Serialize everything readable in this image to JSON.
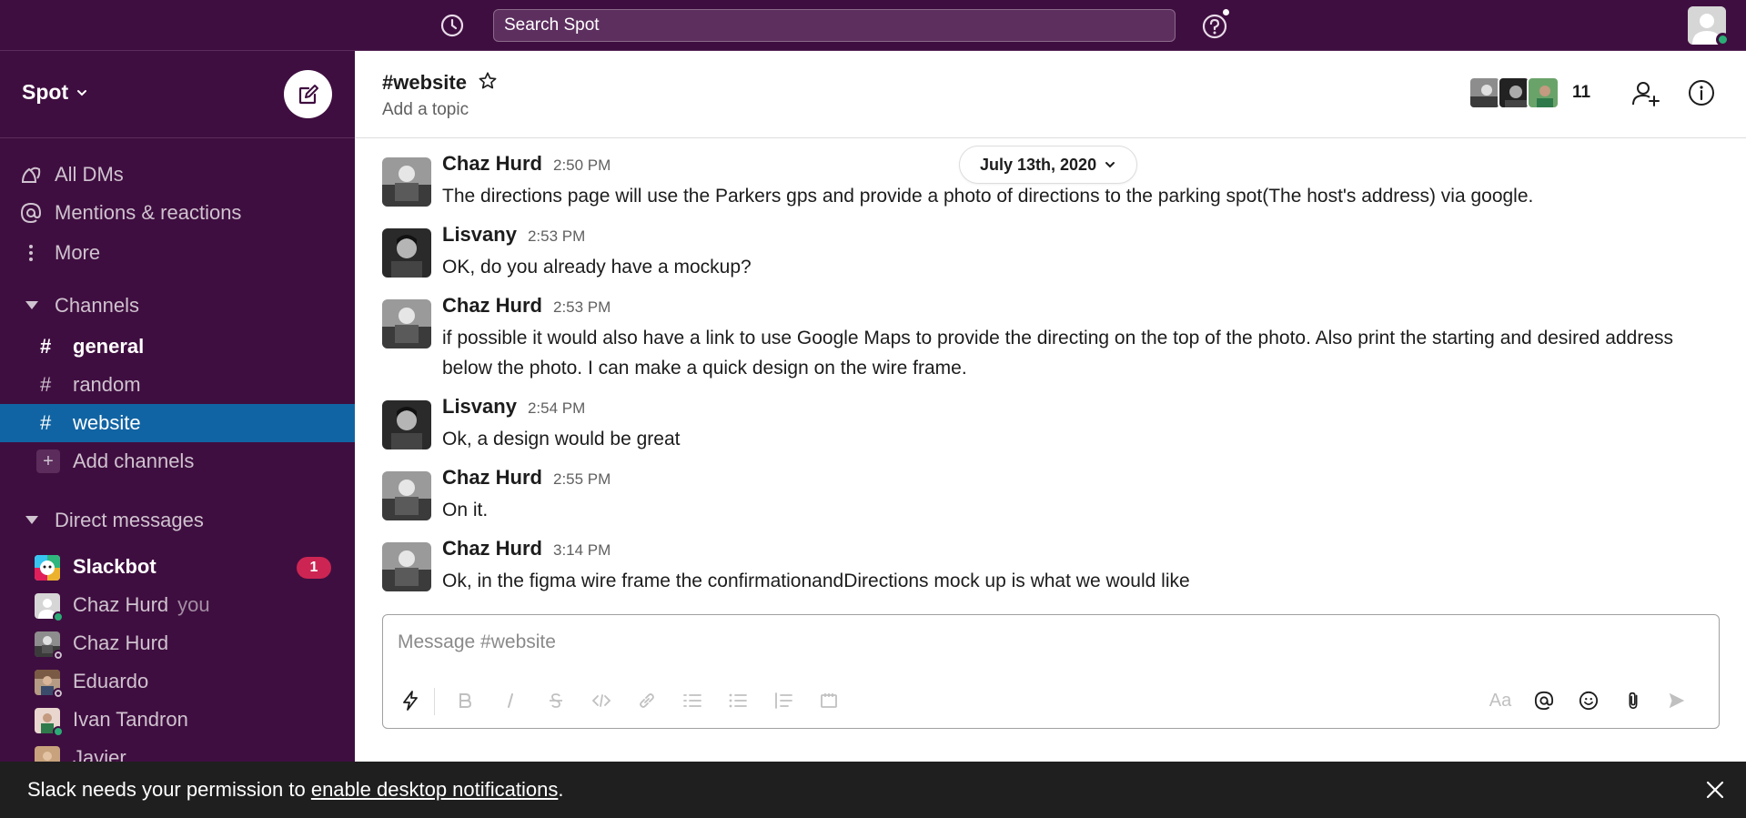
{
  "colors": {
    "sidebar_bg": "#3f0e40",
    "active_channel": "#1164a3",
    "badge": "#cd2553",
    "online": "#2bac76",
    "banner_bg": "#1f1f1f"
  },
  "topbar": {
    "history_icon": "clock-icon",
    "search_placeholder": "Search Spot",
    "help_icon": "question-icon"
  },
  "sidebar": {
    "workspace_name": "Spot",
    "compose_icon": "compose-icon",
    "nav": [
      {
        "label": "All DMs",
        "icon": "dms-icon"
      },
      {
        "label": "Mentions & reactions",
        "icon": "at-icon"
      },
      {
        "label": "More",
        "icon": "kebab-icon"
      }
    ],
    "channels_heading": "Channels",
    "channels": [
      {
        "name": "general",
        "state": "unread"
      },
      {
        "name": "random",
        "state": "read"
      },
      {
        "name": "website",
        "state": "active"
      }
    ],
    "add_channels": "Add channels",
    "dms_heading": "Direct messages",
    "dms": [
      {
        "name": "Slackbot",
        "badge": "1",
        "suffix": "",
        "status": "none"
      },
      {
        "name": "Chaz Hurd",
        "badge": "",
        "suffix": "you",
        "status": "online"
      },
      {
        "name": "Chaz Hurd",
        "badge": "",
        "suffix": "",
        "status": "away"
      },
      {
        "name": "Eduardo",
        "badge": "",
        "suffix": "",
        "status": "away"
      },
      {
        "name": "Ivan Tandron",
        "badge": "",
        "suffix": "",
        "status": "online"
      },
      {
        "name": "Javier",
        "badge": "",
        "suffix": "",
        "status": "none"
      }
    ]
  },
  "channel_header": {
    "title": "#website",
    "topic": "Add a topic",
    "member_count": "11"
  },
  "date_divider": "July 13th, 2020",
  "messages": [
    {
      "author": "Chaz Hurd",
      "time": "2:50 PM",
      "text": "The directions page will use the Parkers gps and provide a photo of directions to the parking spot(The host's address) via google."
    },
    {
      "author": "Lisvany",
      "time": "2:53 PM",
      "text": "OK, do you already have a mockup?"
    },
    {
      "author": "Chaz Hurd",
      "time": "2:53 PM",
      "text": "if possible it would also have a link to use Google Maps to provide the directing on the top of the photo. Also print the starting and desired address below the photo. I can make a quick design on the wire frame."
    },
    {
      "author": "Lisvany",
      "time": "2:54 PM",
      "text": "Ok, a design would be great"
    },
    {
      "author": "Chaz Hurd",
      "time": "2:55 PM",
      "text": "On it."
    },
    {
      "author": "Chaz Hurd",
      "time": "3:14 PM",
      "text": "Ok, in the figma wire frame the confirmationandDirections mock up is what we would like"
    }
  ],
  "composer": {
    "placeholder": "Message #website",
    "format_label": "Aa"
  },
  "banner": {
    "prefix": "Slack needs your permission to ",
    "link": "enable desktop notifications",
    "suffix": "."
  }
}
